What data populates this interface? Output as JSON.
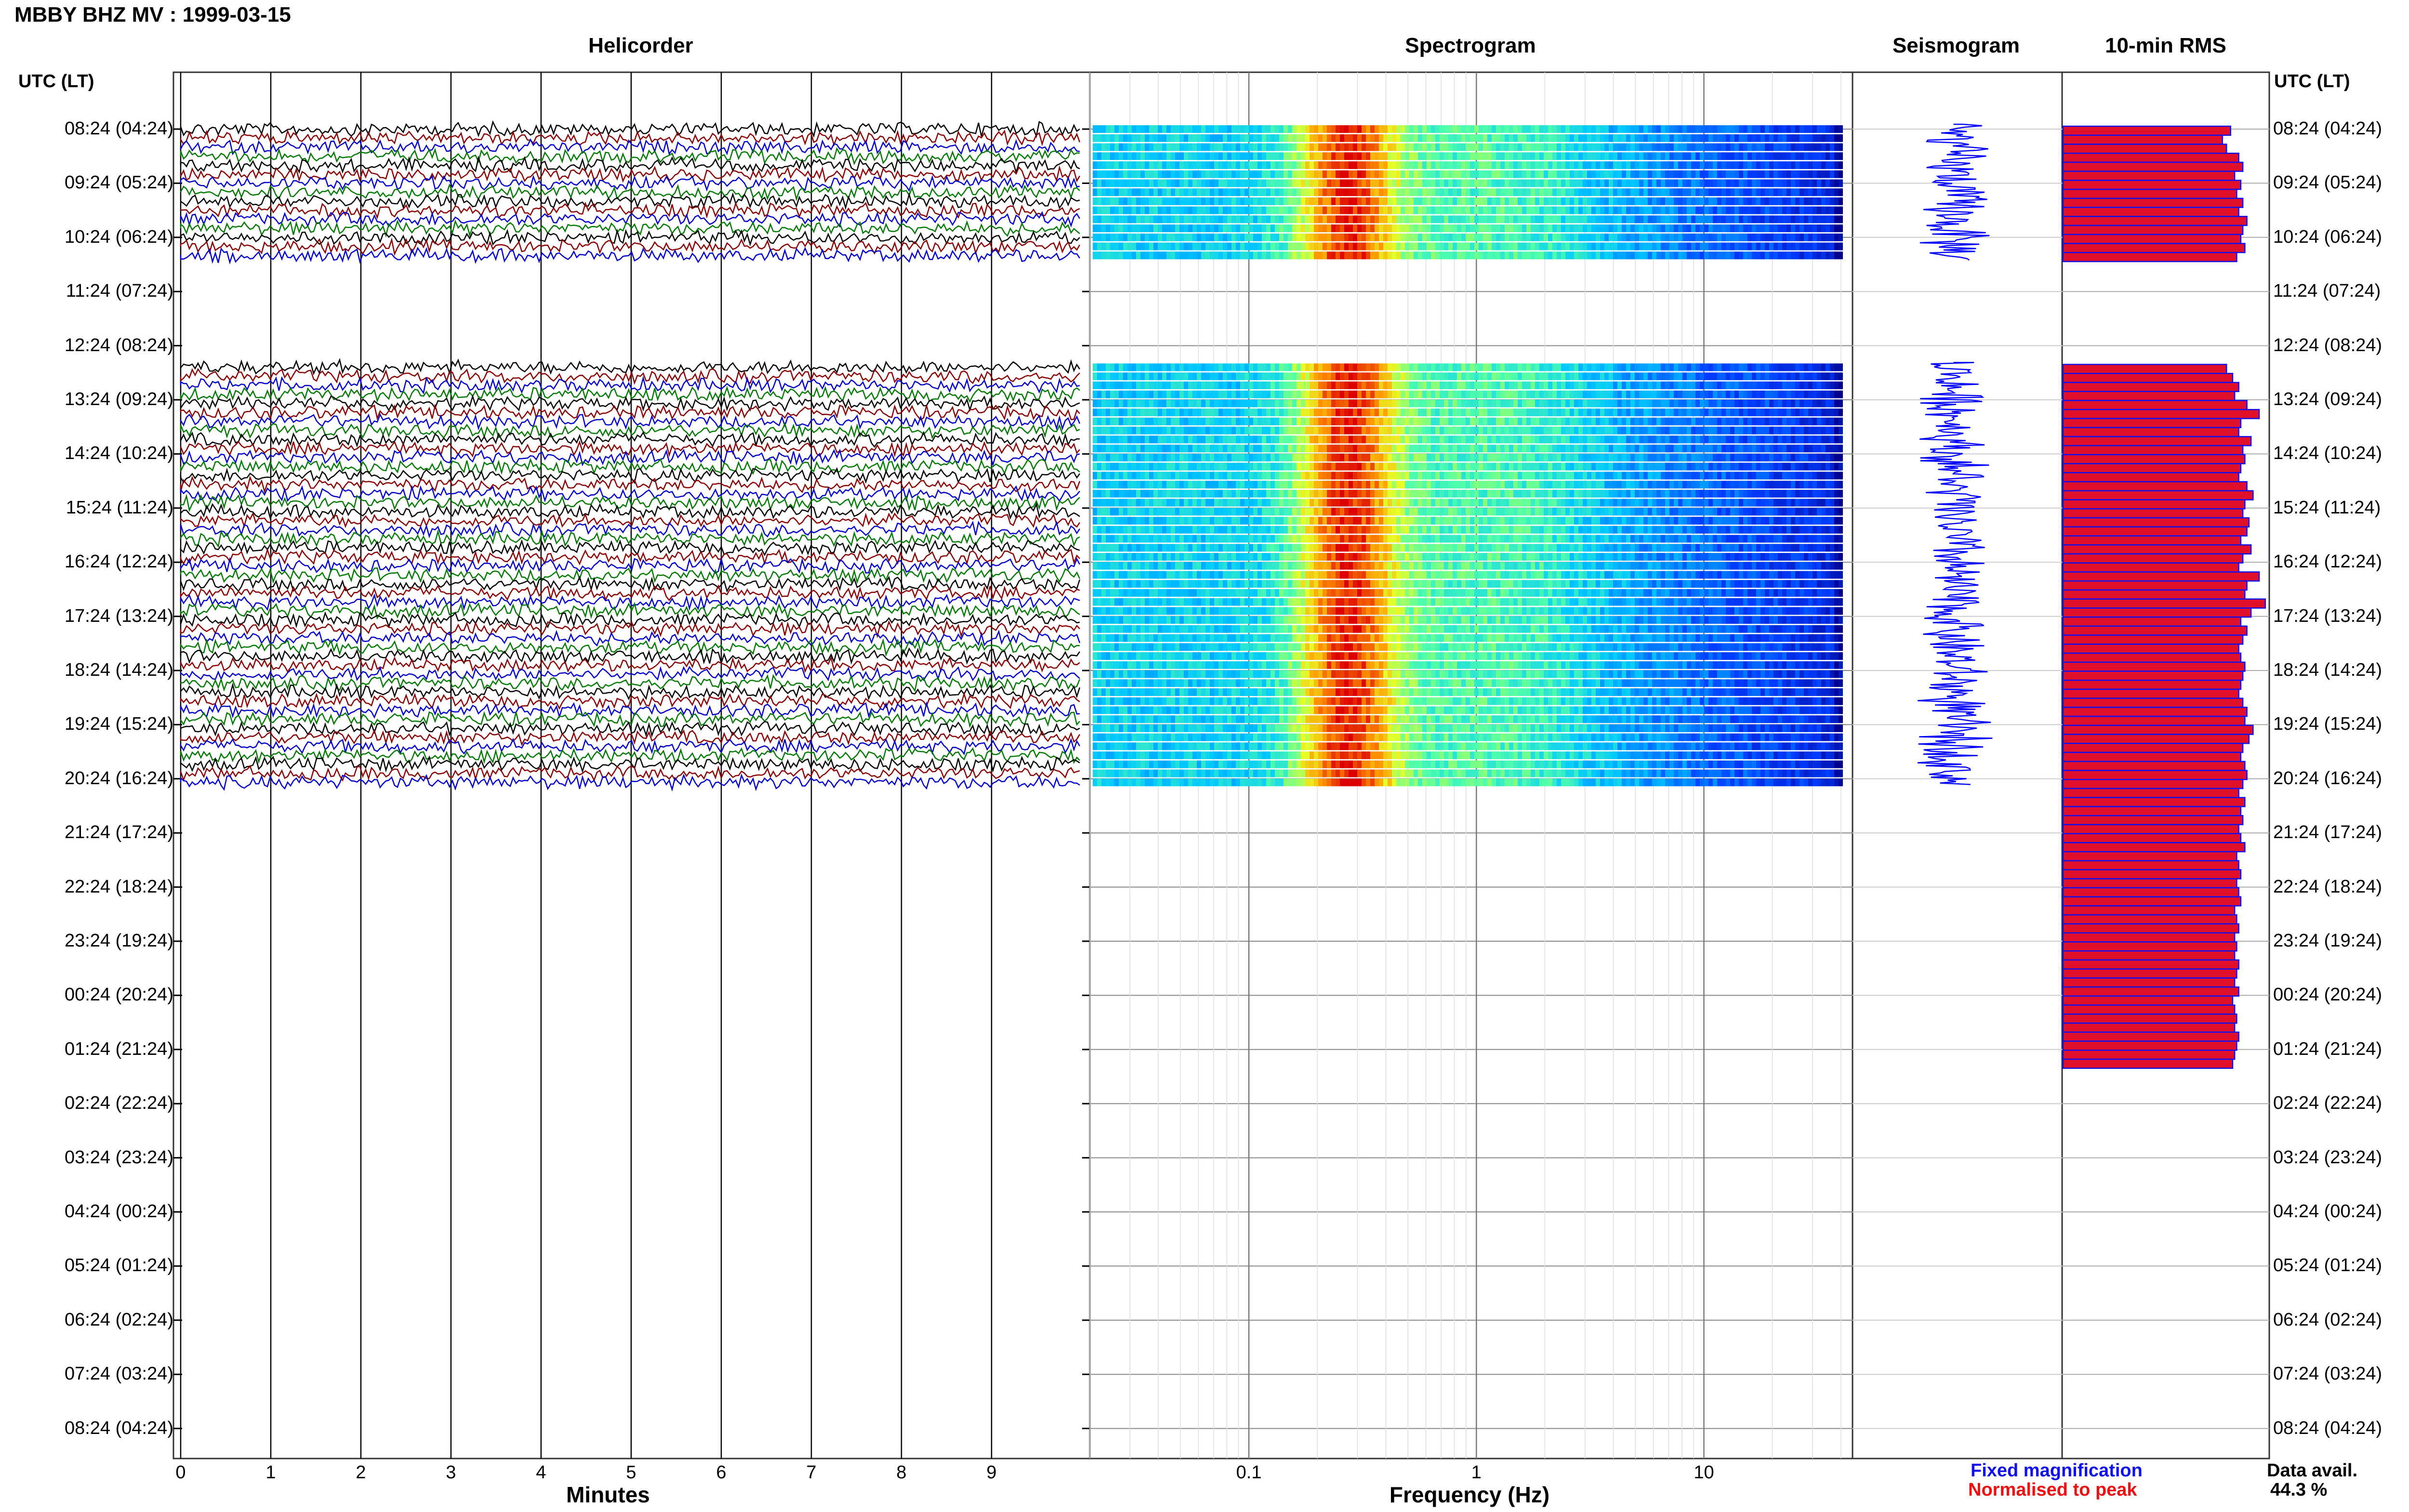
{
  "title": "MBBY BHZ MV : 1999-03-15",
  "panels": {
    "helicorder": "Helicorder",
    "spectrogram": "Spectrogram",
    "seismogram": "Seismogram",
    "rms": "10-min RMS"
  },
  "time_axis_label": "UTC (LT)",
  "time_labels": [
    "08:24 (04:24)",
    "09:24 (05:24)",
    "10:24 (06:24)",
    "11:24 (07:24)",
    "12:24 (08:24)",
    "13:24 (09:24)",
    "14:24 (10:24)",
    "15:24 (11:24)",
    "16:24 (12:24)",
    "17:24 (13:24)",
    "18:24 (14:24)",
    "19:24 (15:24)",
    "20:24 (16:24)",
    "21:24 (17:24)",
    "22:24 (18:24)",
    "23:24 (19:24)",
    "00:24 (20:24)",
    "01:24 (21:24)",
    "02:24 (22:24)",
    "03:24 (23:24)",
    "04:24 (00:24)",
    "05:24 (01:24)",
    "06:24 (02:24)",
    "07:24 (03:24)",
    "08:24 (04:24)"
  ],
  "x_axes": {
    "helicorder": {
      "label": "Minutes",
      "ticks": [
        "0",
        "1",
        "2",
        "3",
        "4",
        "5",
        "6",
        "7",
        "8",
        "9"
      ]
    },
    "spectrogram": {
      "label": "Frequency (Hz)",
      "ticks": [
        "0.1",
        "1",
        "10"
      ],
      "scale": "log"
    }
  },
  "legend": {
    "fixed": "Fixed magnification",
    "normalised": "Normalised to peak"
  },
  "data_availability": {
    "label": "Data avail.",
    "value": "44.3 %"
  },
  "colors": {
    "trace_cycle": [
      "#000000",
      "#8b0000",
      "#0000cc",
      "#007a00"
    ],
    "seismogram": "#0000ff",
    "rms_fill": "#e0102a",
    "rms_edge": "#1010ee"
  },
  "chart_data": [
    {
      "type": "line",
      "name": "helicorder",
      "xlabel": "Minutes",
      "xlim": [
        0,
        10
      ],
      "row_hour_marks": 25,
      "data_segments_hours": [
        [
          0,
          2.5
        ],
        [
          4.4,
          12.2
        ]
      ],
      "grid": true
    },
    {
      "type": "heatmap",
      "name": "spectrogram",
      "xlabel": "Frequency (Hz)",
      "xscale": "log",
      "xlim": [
        0.02,
        45
      ],
      "data_segments_hours": [
        [
          0,
          2.5
        ],
        [
          4.4,
          12.2
        ]
      ],
      "peak_band_hz": [
        0.15,
        0.5
      ],
      "grid": true
    },
    {
      "type": "line",
      "name": "seismogram",
      "data_segments_hours": [
        [
          0,
          2.5
        ],
        [
          4.4,
          12.2
        ]
      ]
    },
    {
      "type": "bar",
      "name": "10-min RMS",
      "orientation": "horizontal",
      "segments": [
        {
          "start_hour": 0.0,
          "values": [
            0.82,
            0.78,
            0.8,
            0.86,
            0.88,
            0.84,
            0.87,
            0.85,
            0.88,
            0.86,
            0.9,
            0.88,
            0.87,
            0.89,
            0.85
          ]
        },
        {
          "start_hour": 4.4,
          "values": [
            0.8,
            0.83,
            0.86,
            0.84,
            0.9,
            0.96,
            0.87,
            0.86,
            0.92,
            0.88,
            0.89,
            0.87,
            0.86,
            0.9,
            0.93,
            0.89,
            0.88,
            0.91,
            0.9,
            0.87,
            0.92,
            0.88,
            0.86,
            0.96,
            0.9,
            0.89,
            0.99,
            0.92,
            0.87,
            0.9,
            0.88,
            0.86,
            0.87,
            0.89,
            0.88,
            0.87,
            0.86,
            0.88,
            0.9,
            0.89,
            0.93,
            0.91,
            0.88,
            0.87,
            0.89,
            0.9,
            0.88,
            0.86,
            0.89,
            0.87,
            0.88,
            0.86,
            0.87,
            0.89,
            0.85,
            0.86,
            0.87,
            0.85,
            0.86,
            0.87,
            0.84,
            0.85,
            0.86,
            0.84,
            0.85,
            0.84,
            0.86,
            0.85,
            0.84,
            0.86,
            0.83,
            0.84,
            0.85,
            0.84,
            0.86,
            0.85,
            0.84,
            0.83
          ]
        }
      ]
    }
  ]
}
